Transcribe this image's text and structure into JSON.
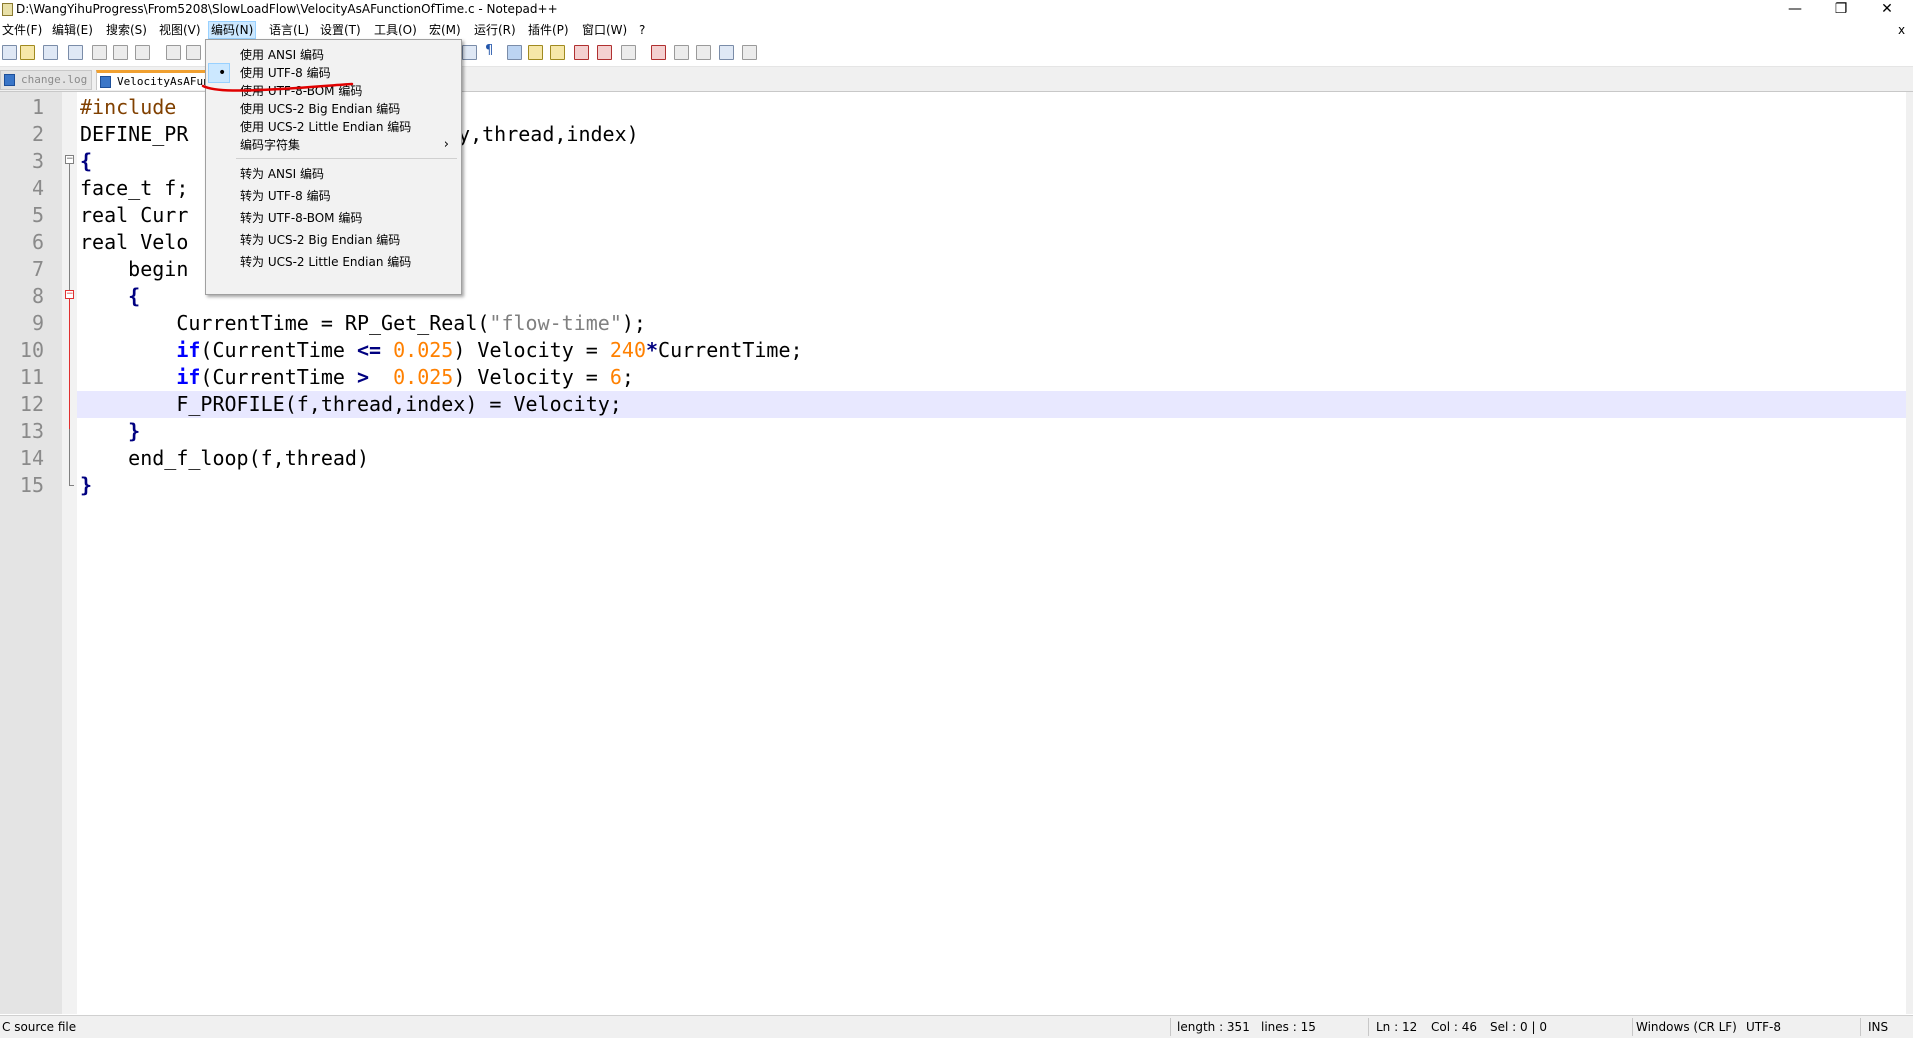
{
  "window": {
    "title": "D:\\WangYihuProgress\\From5208\\SlowLoadFlow\\VelocityAsAFunctionOfTime.c - Notepad++",
    "minimize": "—",
    "restore": "❐",
    "close": "✕",
    "menubar_close": "x"
  },
  "menu": [
    "文件(F)",
    "编辑(E)",
    "搜索(S)",
    "视图(V)",
    "编码(N)",
    "语言(L)",
    "设置(T)",
    "工具(O)",
    "宏(M)",
    "运行(R)",
    "插件(P)",
    "窗口(W)",
    "?"
  ],
  "menu_active": "编码(N)",
  "tabs": [
    {
      "label": "change.log",
      "active": false
    },
    {
      "label": "VelocityAsAFunctionOfTime.c",
      "active": true
    }
  ],
  "encoding_menu": {
    "use": [
      "使用 ANSI 编码",
      "使用 UTF-8 编码",
      "使用 UTF-8-BOM 编码",
      "使用 UCS-2 Big Endian 编码",
      "使用 UCS-2 Little Endian 编码"
    ],
    "charset": "编码字符集",
    "charset_arrow": "›",
    "convert": [
      "转为 ANSI 编码",
      "转为 UTF-8 编码",
      "转为 UTF-8-BOM 编码",
      "转为 UCS-2 Big Endian 编码",
      "转为 UCS-2 Little Endian 编码"
    ],
    "checked": "使用 UTF-8 编码",
    "bullet": "•"
  },
  "editor": {
    "line_numbers": [
      "1",
      "2",
      "3",
      "4",
      "5",
      "6",
      "7",
      "8",
      "9",
      "10",
      "11",
      "12",
      "13",
      "14",
      "15"
    ],
    "current_line": 12,
    "lines_visible": {
      "l1": "#include",
      "l2a": "DEFINE_PR",
      "l2b": "ty,thread,index)",
      "l3": "{",
      "l4": "face_t f;",
      "l5": "real Curr",
      "l6": "real Velo",
      "l7": "    begin",
      "l8": "    {",
      "l9a": "        CurrentTime = RP_Get_Real(",
      "l9b": "\"flow-time\"",
      "l9c": ");",
      "l10a": "if",
      "l10b": "(CurrentTime ",
      "l10c": "<=",
      "l10d": "0.025",
      "l10e": ") Velocity = ",
      "l10f": "240",
      "l10g": "*",
      "l10h": "CurrentTime;",
      "l11a": "if",
      "l11b": "(CurrentTime ",
      "l11c": ">",
      "l11d": "0.025",
      "l11e": ") Velocity = ",
      "l11f": "6",
      "l11g": ";",
      "l12": "        F_PROFILE(f,thread,index) = Velocity;",
      "l13": "    }",
      "l14": "    end_f_loop(f,thread)",
      "l15": "}"
    }
  },
  "status": {
    "filetype": "C source file",
    "length": "length : 351",
    "lines": "lines : 15",
    "ln": "Ln : 12",
    "col": "Col : 46",
    "sel": "Sel : 0 | 0",
    "eol": "Windows (CR LF)",
    "encoding": "UTF-8",
    "mode": "INS"
  },
  "colors": {
    "keyword": "#0000ff",
    "number": "#ff8000",
    "string": "#808080",
    "preprocessor": "#804000",
    "annotation": "#e00000"
  }
}
